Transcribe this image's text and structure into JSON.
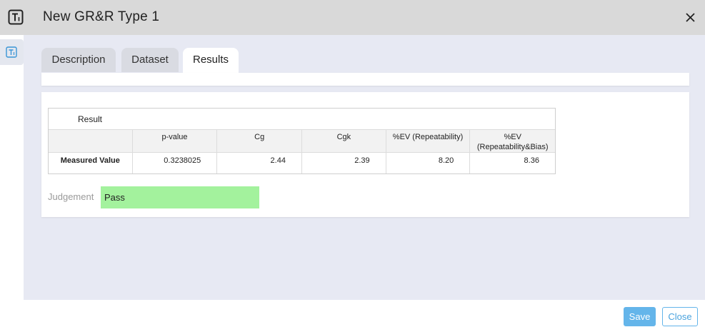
{
  "window": {
    "title": "New GR&R Type 1",
    "app_icon": "ti-icon",
    "close_icon": "close-icon"
  },
  "sidebar": {
    "items": [
      {
        "icon": "ti-icon",
        "active": true
      }
    ]
  },
  "tabs": [
    {
      "label": "Description",
      "active": false
    },
    {
      "label": "Dataset",
      "active": false
    },
    {
      "label": "Results",
      "active": true
    }
  ],
  "results": {
    "caption": "Result",
    "columns": [
      "",
      "p-value",
      "Cg",
      "Cgk",
      "%EV (Repeatability)",
      "%EV\n(Repeatability&Bias)"
    ],
    "rows": [
      {
        "label": "Measured Value",
        "values": [
          "0.3238025",
          "2.44",
          "2.39",
          "8.20",
          "8.36"
        ]
      }
    ]
  },
  "judgement": {
    "label": "Judgement",
    "value": "Pass",
    "color": "#a3f29d"
  },
  "footer": {
    "save_label": "Save",
    "close_label": "Close"
  },
  "colors": {
    "accent": "#64b5ea",
    "titlebar": "#d9d9d9",
    "background": "#e7e9f3"
  }
}
